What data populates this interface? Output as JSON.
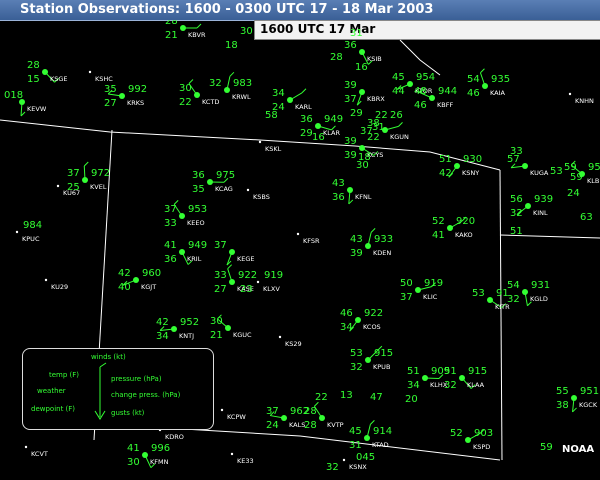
{
  "title": "Station Observations: 1600 - 0300 UTC  17 - 18 Mar 2003",
  "time_label": "1600 UTC 17  Mar",
  "credit": "NOAA",
  "colors": {
    "obs": "#33ff33",
    "station_id": "#ffffff",
    "state_lines": "#ffffff",
    "title_bar": "#3f66a0"
  },
  "legend": {
    "winds": "winds (kt)",
    "temp": "temp (F)",
    "weather": "weather",
    "dewpoint": "dewpoint (F)",
    "pressure": "pressure (hPa)",
    "change": "change press. (hPa)",
    "gusts": "gusts (kt)"
  },
  "stations": [
    {
      "id": "KBVR",
      "temp": "28",
      "dew": "21"
    },
    {
      "id": "KSGE",
      "temp": "28",
      "dew": "15"
    },
    {
      "id": "KEVW",
      "temp": "018",
      "dew": ""
    },
    {
      "id": "KSHC",
      "temp": "",
      "dew": ""
    },
    {
      "id": "KRKS",
      "temp": "35",
      "dew": "27",
      "press": "992"
    },
    {
      "id": "KCTD",
      "temp": "30",
      "dew": "22"
    },
    {
      "id": "KRWL",
      "temp": "32",
      "dew": "",
      "press": "983"
    },
    {
      "id": "KARL",
      "temp": "34",
      "dew": "24"
    },
    {
      "id": "KLAR",
      "temp": "36",
      "dew": "29",
      "press": "949"
    },
    {
      "id": "KSIB",
      "temp": "36",
      "dew": ""
    },
    {
      "id": "KBRX",
      "temp": "39",
      "dew": "37"
    },
    {
      "id": "KTOR",
      "temp": "45",
      "dew": "44",
      "press": "954"
    },
    {
      "id": "KBFF",
      "temp": "48",
      "dew": "46",
      "press": "944"
    },
    {
      "id": "KAIA",
      "temp": "54",
      "dew": "46",
      "press": "935"
    },
    {
      "id": "KNHN",
      "temp": "",
      "dew": ""
    },
    {
      "id": "KGUN",
      "temp": "38",
      "dew": "22"
    },
    {
      "id": "KCYS",
      "temp": "39",
      "dew": "39"
    },
    {
      "id": "KSKL",
      "temp": "",
      "dew": ""
    },
    {
      "id": "KSNY",
      "temp": "51",
      "dew": "42",
      "press": "930"
    },
    {
      "id": "KUGA",
      "temp": "57",
      "dew": ""
    },
    {
      "id": "KLBF",
      "temp": "59",
      "dew": "",
      "press": "95"
    },
    {
      "id": "KVEL",
      "temp": "37",
      "dew": "25",
      "press": "972"
    },
    {
      "id": "KU67",
      "temp": "",
      "dew": ""
    },
    {
      "id": "KCAG",
      "temp": "36",
      "dew": "35",
      "press": "975"
    },
    {
      "id": "KSBS",
      "temp": "",
      "dew": ""
    },
    {
      "id": "KFNL",
      "temp": "43",
      "dew": "36"
    },
    {
      "id": "KINL",
      "temp": "56",
      "dew": "32",
      "press": "939"
    },
    {
      "id": "KPUC",
      "temp": "",
      "dew": "",
      "press": "984"
    },
    {
      "id": "KEEO",
      "temp": "37",
      "dew": "33",
      "press": "953"
    },
    {
      "id": "KDEN",
      "temp": "43",
      "dew": "39",
      "press": "933"
    },
    {
      "id": "KAKO",
      "temp": "52",
      "dew": "41",
      "press": "920"
    },
    {
      "id": "KFSR",
      "temp": "",
      "dew": ""
    },
    {
      "id": "KRIL",
      "temp": "41",
      "dew": "36",
      "press": "949"
    },
    {
      "id": "KEGE",
      "temp": "37",
      "dew": ""
    },
    {
      "id": "KGJT",
      "temp": "42",
      "dew": "40",
      "press": "960"
    },
    {
      "id": "KU29",
      "temp": "",
      "dew": ""
    },
    {
      "id": "KASE",
      "temp": "33",
      "dew": "27",
      "press": "922"
    },
    {
      "id": "KLXV",
      "temp": "",
      "dew": "23",
      "press": "919"
    },
    {
      "id": "KLIC",
      "temp": "50",
      "dew": "37",
      "press": "919"
    },
    {
      "id": "KITR",
      "temp": "53",
      "dew": "",
      "press": "91"
    },
    {
      "id": "KGLD",
      "temp": "54",
      "dew": "32",
      "press": "931"
    },
    {
      "id": "KCOS",
      "temp": "46",
      "dew": "34",
      "press": "922"
    },
    {
      "id": "KNTJ",
      "temp": "42",
      "dew": "34",
      "press": "952"
    },
    {
      "id": "KGUC",
      "temp": "30",
      "dew": "21"
    },
    {
      "id": "KS29",
      "temp": "",
      "dew": ""
    },
    {
      "id": "KPUB",
      "temp": "53",
      "dew": "32",
      "press": "915"
    },
    {
      "id": "KLHX",
      "temp": "51",
      "dew": "34",
      "press": "909"
    },
    {
      "id": "KLAA",
      "temp": "51",
      "dew": "32",
      "press": "915"
    },
    {
      "id": "KGCK",
      "temp": "55",
      "dew": "38",
      "press": "951"
    },
    {
      "id": "KCPW",
      "temp": "",
      "dew": ""
    },
    {
      "id": "KALS",
      "temp": "37",
      "dew": "24",
      "press": "962"
    },
    {
      "id": "KVTP",
      "temp": "28",
      "dew": "28"
    },
    {
      "id": "KTAD",
      "temp": "45",
      "dew": "31",
      "press": "914"
    },
    {
      "id": "KSPD",
      "temp": "52",
      "dew": "",
      "press": "903"
    },
    {
      "id": "KDRO",
      "temp": "",
      "dew": ""
    },
    {
      "id": "KFMN",
      "temp": "41",
      "dew": "30",
      "press": "996"
    },
    {
      "id": "KE33",
      "temp": "",
      "dew": ""
    },
    {
      "id": "KCVT",
      "temp": "",
      "dew": ""
    },
    {
      "id": "KSNX",
      "temp": "",
      "dew": "32"
    }
  ],
  "extra_numbers": [
    "30",
    "18",
    "31",
    "28",
    "16",
    "29",
    "58",
    "22",
    "26",
    "30",
    "37",
    "16",
    "31",
    "18",
    "33",
    "59",
    "53",
    "24",
    "63",
    "51",
    "20",
    "22",
    "13",
    "47",
    "045",
    "59"
  ]
}
